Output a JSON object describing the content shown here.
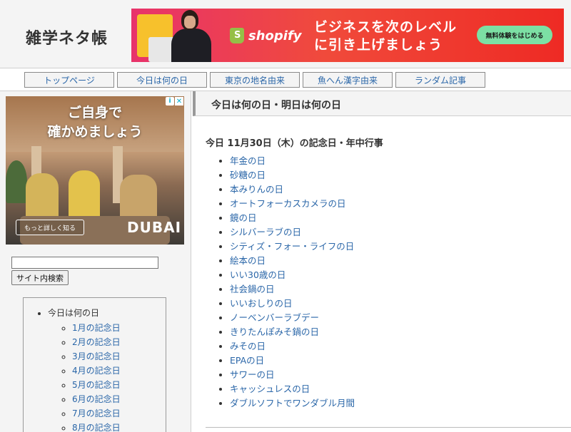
{
  "header": {
    "site_title": "雑学ネタ帳",
    "banner": {
      "brand": "shopify",
      "headline_line1": "ビジネスを次のレベル",
      "headline_line2": "に引き上げましょう",
      "cta": "無料体験をはじめる"
    }
  },
  "nav": {
    "items": [
      {
        "label": "トップページ"
      },
      {
        "label": "今日は何の日"
      },
      {
        "label": "東京の地名由来"
      },
      {
        "label": "魚へん漢字由来"
      },
      {
        "label": "ランダム記事"
      }
    ]
  },
  "sidebar": {
    "ad": {
      "headline_line1": "ご自身で",
      "headline_line2": "確かめましょう",
      "cta": "もっと詳しく知る",
      "brand": "DUBAI"
    },
    "search": {
      "input_value": "",
      "button_label": "サイト内検索"
    },
    "menu": {
      "top_label": "今日は何の日",
      "items": [
        {
          "label": "1月の記念日"
        },
        {
          "label": "2月の記念日"
        },
        {
          "label": "3月の記念日"
        },
        {
          "label": "4月の記念日"
        },
        {
          "label": "5月の記念日"
        },
        {
          "label": "6月の記念日"
        },
        {
          "label": "7月の記念日"
        },
        {
          "label": "8月の記念日"
        }
      ]
    }
  },
  "main": {
    "heading": "今日は何の日・明日は何の日",
    "today_heading": "今日 11月30日（木）の記念日・年中行事",
    "events": [
      "年金の日",
      "砂糖の日",
      "本みりんの日",
      "オートフォーカスカメラの日",
      "鏡の日",
      "シルバーラブの日",
      "シティズ・フォー・ライフの日",
      "絵本の日",
      "いい30歳の日",
      "社会鍋の日",
      "いいおしりの日",
      "ノーベンバーラブデー",
      "きりたんぽみそ鍋の日",
      "みその日",
      "EPAの日",
      "サワーの日",
      "キャッシュレスの日",
      "ダブルソフトでワンダブル月間"
    ]
  },
  "colors": {
    "link": "#2a66a8",
    "background": "#f4f4f4",
    "banner_pink": "#e8336b",
    "banner_red": "#ee2a24",
    "cta_green": "#7ce0a4",
    "shopify_green": "#95bf47"
  }
}
